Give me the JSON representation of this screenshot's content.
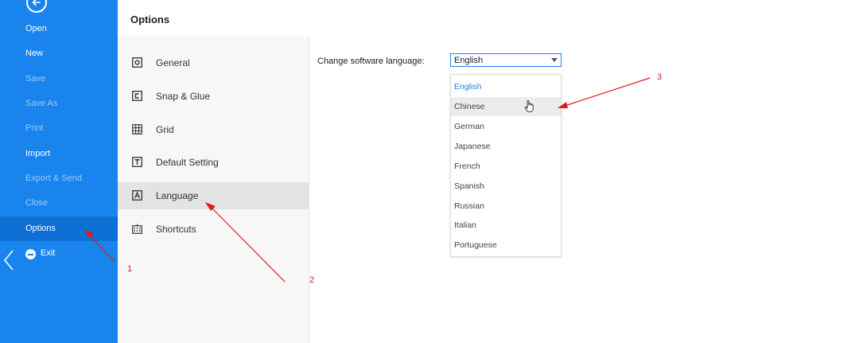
{
  "sidebar": {
    "items": [
      {
        "label": "Open",
        "enabled": true
      },
      {
        "label": "New",
        "enabled": true
      },
      {
        "label": "Save",
        "enabled": false
      },
      {
        "label": "Save As",
        "enabled": false
      },
      {
        "label": "Print",
        "enabled": false
      },
      {
        "label": "Import",
        "enabled": true
      },
      {
        "label": "Export & Send",
        "enabled": false
      },
      {
        "label": "Close",
        "enabled": false
      },
      {
        "label": "Options",
        "enabled": true,
        "active": true
      },
      {
        "label": "Exit",
        "enabled": true,
        "icon": "minus-circle-icon"
      }
    ]
  },
  "header": {
    "title": "Options"
  },
  "categories": [
    {
      "label": "General",
      "icon": "gear-icon"
    },
    {
      "label": "Snap & Glue",
      "icon": "snap-icon"
    },
    {
      "label": "Grid",
      "icon": "grid-icon"
    },
    {
      "label": "Default Setting",
      "icon": "text-t-icon"
    },
    {
      "label": "Language",
      "icon": "language-icon",
      "active": true
    },
    {
      "label": "Shortcuts",
      "icon": "keyboard-icon"
    }
  ],
  "language_setting": {
    "label": "Change software language:",
    "selected": "English",
    "options": [
      "English",
      "Chinese",
      "German",
      "Japanese",
      "French",
      "Spanish",
      "Russian",
      "Italian",
      "Portuguese"
    ],
    "hovered": "Chinese"
  },
  "annotations": {
    "n1": "1",
    "n2": "2",
    "n3": "3",
    "color": "#e01a1a"
  },
  "colors": {
    "sidebar": "#1a84ee",
    "accent": "#1a84ee"
  }
}
